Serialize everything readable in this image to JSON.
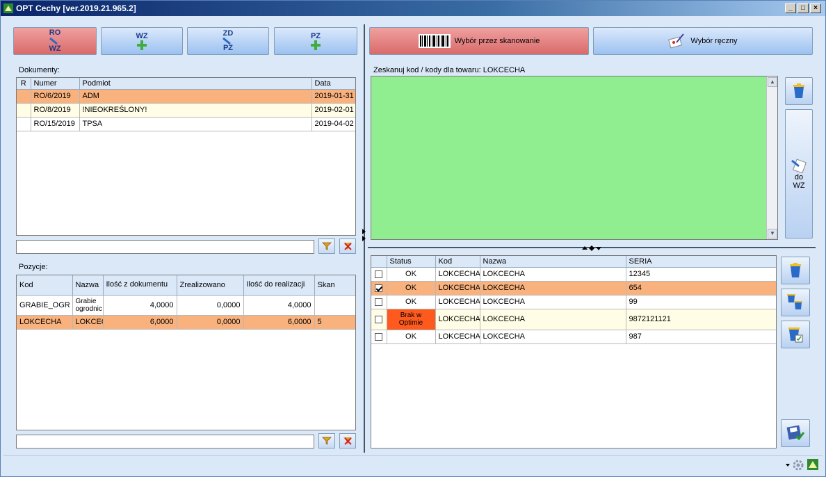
{
  "window": {
    "title": "OPT Cechy [ver.2019.21.965.2]"
  },
  "toolbar": {
    "ro_wz": {
      "top": "RO",
      "bottom": "WZ"
    },
    "wz": {
      "top": "WZ"
    },
    "zd_pz": {
      "top": "ZD",
      "bottom": "PZ"
    },
    "pz": {
      "top": "PZ"
    },
    "scan_label": "Wybór przez skanowanie",
    "manual_label": "Wybór ręczny"
  },
  "documents": {
    "label": "Dokumenty:",
    "columns": [
      "R",
      "Numer",
      "Podmiot",
      "Data"
    ],
    "rows": [
      {
        "r": "",
        "numer": "RO/6/2019",
        "podmiot": "ADM",
        "data": "2019-01-31"
      },
      {
        "r": "",
        "numer": "RO/8/2019",
        "podmiot": "!NIEOKREŚLONY!",
        "data": "2019-02-01"
      },
      {
        "r": "",
        "numer": "RO/15/2019",
        "podmiot": "TPSA",
        "data": "2019-04-02"
      }
    ]
  },
  "positions": {
    "label": "Pozycje:",
    "columns": [
      "Kod",
      "Nazwa",
      "Ilość z dokumentu",
      "Zrealizowano",
      "Ilość do realizacji",
      "Skan"
    ],
    "rows": [
      {
        "kod": "GRABIE_OGR",
        "nazwa": "Grabie ogrodnic",
        "ilosc": "4,0000",
        "zreal": "0,0000",
        "doreal": "4,0000",
        "skan": ""
      },
      {
        "kod": "LOKCECHA",
        "nazwa": "LOKCEC",
        "ilosc": "6,0000",
        "zreal": "0,0000",
        "doreal": "6,0000",
        "skan": "5"
      }
    ]
  },
  "scan": {
    "label": "Zeskanuj kod / kody dla towaru: LOKCECHA"
  },
  "side": {
    "to_wz": "do\nWZ"
  },
  "series": {
    "columns": [
      "",
      "Status",
      "Kod",
      "Nazwa",
      "SERIA"
    ],
    "rows": [
      {
        "checked": false,
        "status": "OK",
        "kod": "LOKCECHA",
        "nazwa": "LOKCECHA",
        "seria": "12345",
        "style": ""
      },
      {
        "checked": true,
        "status": "OK",
        "kod": "LOKCECHA",
        "nazwa": "LOKCECHA",
        "seria": "654",
        "style": "sel"
      },
      {
        "checked": false,
        "status": "OK",
        "kod": "LOKCECHA",
        "nazwa": "LOKCECHA",
        "seria": "99",
        "style": ""
      },
      {
        "checked": false,
        "status": "Brak w Optimie",
        "kod": "LOKCECHA",
        "nazwa": "LOKCECHA",
        "seria": "9872121121",
        "style": "alt"
      },
      {
        "checked": false,
        "status": "OK",
        "kod": "LOKCECHA",
        "nazwa": "LOKCECHA",
        "seria": "987",
        "style": ""
      }
    ]
  },
  "icons": [
    "app-logo-icon",
    "minimize-icon",
    "maximize-icon",
    "close-icon",
    "barcode-icon",
    "hand-pick-icon",
    "funnel-icon",
    "clear-filter-icon",
    "bin-icon",
    "arrow-doc-icon",
    "save-icon",
    "gear-icon"
  ]
}
